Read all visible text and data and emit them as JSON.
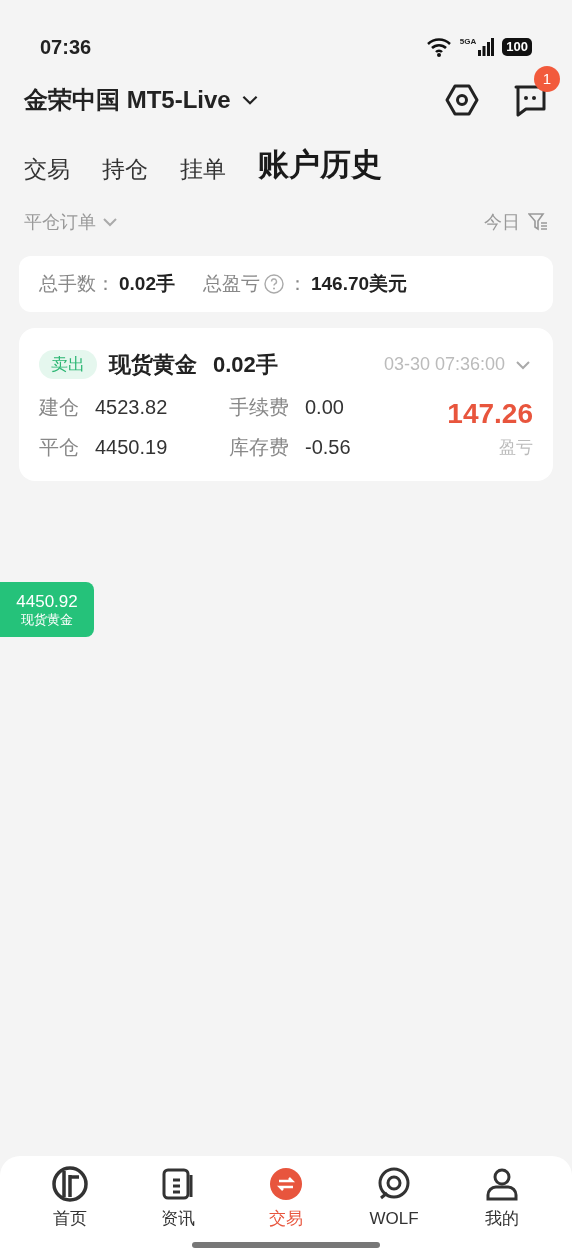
{
  "status_bar": {
    "time": "07:36",
    "network": "5GA",
    "battery": "100"
  },
  "header": {
    "account": "金荣中国 MT5-Live",
    "message_badge": "1"
  },
  "tabs": [
    {
      "label": "交易",
      "selected": false
    },
    {
      "label": "持仓",
      "selected": false
    },
    {
      "label": "挂单",
      "selected": false
    },
    {
      "label": "账户历史",
      "selected": true
    }
  ],
  "filter": {
    "order_type": "平仓订单",
    "period": "今日"
  },
  "summary": {
    "lots_label": "总手数：",
    "lots": "0.02手",
    "pnl_label": "总盈亏",
    "pnl_colon": "：",
    "pnl": "146.70美元"
  },
  "orders": [
    {
      "side": "卖出",
      "symbol": "现货黄金",
      "lots": "0.02手",
      "time": "03-30 07:36:00",
      "fields": [
        {
          "label": "建仓",
          "value": "4523.82"
        },
        {
          "label": "手续费",
          "value": "0.00"
        },
        {
          "label": "平仓",
          "value": "4450.19"
        },
        {
          "label": "库存费",
          "value": "-0.56"
        }
      ],
      "profit": "147.26",
      "profit_label": "盈亏"
    }
  ],
  "price_tag": {
    "price": "4450.92",
    "symbol": "现货黄金"
  },
  "bottom_nav": [
    {
      "label": "首页",
      "kind": "home",
      "selected": false
    },
    {
      "label": "资讯",
      "kind": "news",
      "selected": false
    },
    {
      "label": "交易",
      "kind": "trade",
      "selected": true
    },
    {
      "label": "WOLF",
      "kind": "wolf",
      "selected": false
    },
    {
      "label": "我的",
      "kind": "me",
      "selected": false
    }
  ]
}
